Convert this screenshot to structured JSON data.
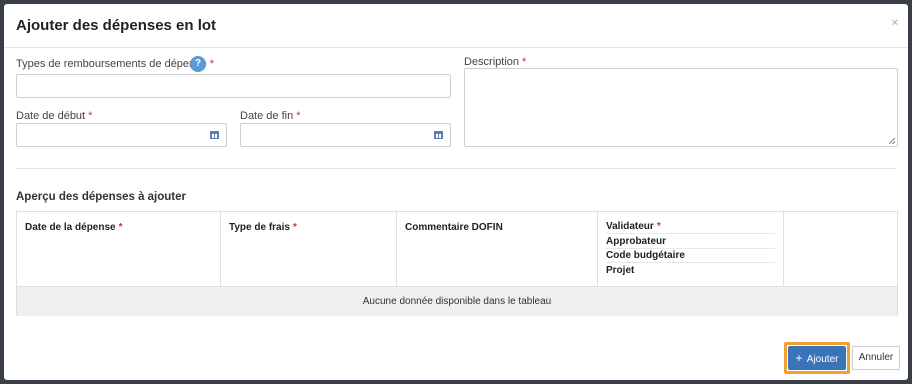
{
  "modal": {
    "title": "Ajouter des dépenses en lot",
    "close": "×"
  },
  "form": {
    "types_label": "Types de remboursements de dépense",
    "required_mark": "*",
    "help_icon": "?",
    "types_value": "",
    "start_label": "Date de début",
    "start_value": "",
    "end_label": "Date de fin",
    "end_value": "",
    "description_label": "Description",
    "description_value": ""
  },
  "preview": {
    "title": "Aperçu des dépenses à ajouter",
    "columns": {
      "date": "Date de la dépense",
      "type": "Type de frais",
      "comment": "Commentaire DOFIN",
      "validator": "Validateur",
      "approver": "Approbateur",
      "budget_code": "Code budgétaire",
      "project": "Projet"
    },
    "empty_message": "Aucune donnée disponible dans le tableau"
  },
  "footer": {
    "add_label": "Ajouter",
    "add_icon": "+",
    "cancel_label": "Annuler"
  },
  "colors": {
    "primary": "#3a74b8",
    "focus": "#f0a030",
    "required": "#c0392b",
    "help": "#5b9bd5"
  }
}
